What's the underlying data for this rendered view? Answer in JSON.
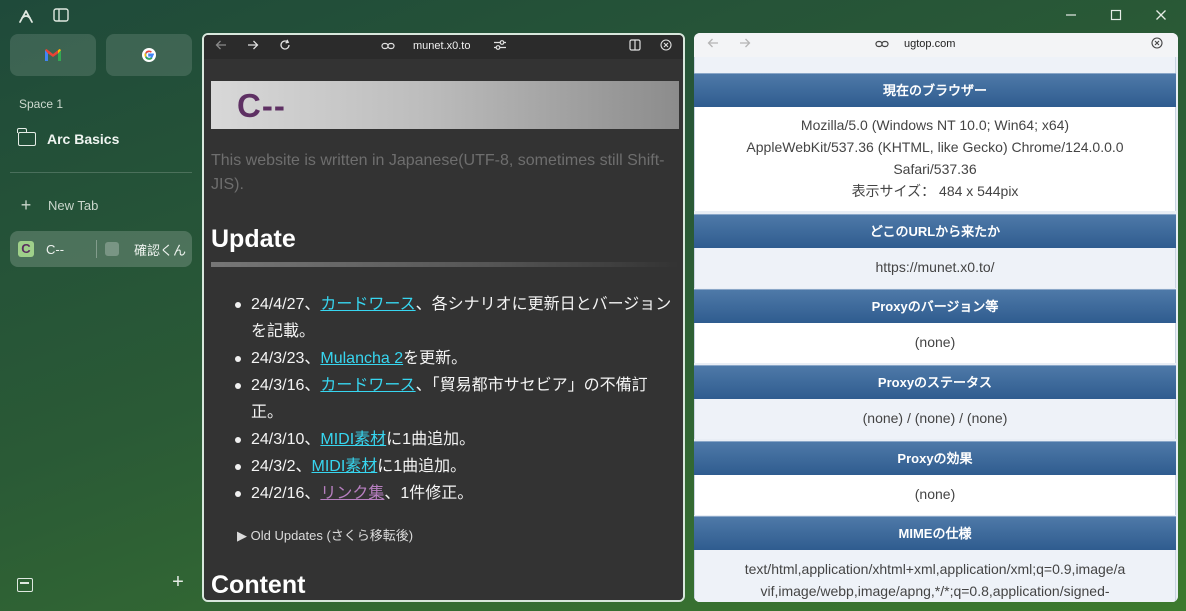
{
  "sidebar": {
    "space_label": "Space 1",
    "folder_label": "Arc Basics",
    "new_tab_label": "New Tab",
    "split_tab": {
      "left_title": "C--",
      "right_title": "確認くん"
    }
  },
  "left_pane": {
    "url": "munet.x0.to",
    "banner_title": "C--",
    "lang_note": "This website is written in Japanese(UTF-8, sometimes still Shift-JIS).",
    "update_heading": "Update",
    "updates": [
      {
        "pre": "24/4/27、",
        "link": "カードワース",
        "post": "、各シナリオに更新日とバージョンを記載。"
      },
      {
        "pre": "24/3/23、",
        "link": "Mulancha 2",
        "post": "を更新。"
      },
      {
        "pre": "24/3/16、",
        "link": "カードワース",
        "post": "、「貿易都市サセビア」の不備訂正。"
      },
      {
        "pre": "24/3/10、",
        "link": "MIDI素材",
        "post": "に1曲追加。"
      },
      {
        "pre": "24/3/2、",
        "link": "MIDI素材",
        "post": "に1曲追加。"
      },
      {
        "pre": "24/2/16、",
        "link": "リンク集",
        "post": "、1件修正。"
      }
    ],
    "old_updates": "▶ Old Updates (さくら移転後)",
    "content_heading": "Content"
  },
  "right_pane": {
    "url": "ugtop.com",
    "sections": [
      {
        "title": "現在のブラウザー",
        "lines": [
          "Mozilla/5.0 (Windows NT 10.0; Win64; x64)",
          "AppleWebKit/537.36 (KHTML, like Gecko) Chrome/124.0.0.0",
          "Safari/537.36",
          "表示サイズ： 484 x 544pix"
        ]
      },
      {
        "title": "どこのURLから来たか",
        "lines": [
          "https://munet.x0.to/"
        ]
      },
      {
        "title": "Proxyのバージョン等",
        "lines": [
          "(none)"
        ]
      },
      {
        "title": "Proxyのステータス",
        "lines": [
          "(none) / (none) / (none)"
        ]
      },
      {
        "title": "Proxyの効果",
        "lines": [
          "(none)"
        ]
      },
      {
        "title": "MIMEの仕様",
        "lines": [
          "text/html,application/xhtml+xml,application/xml;q=0.9,image/a",
          "vif,image/webp,image/apng,*/*;q=0.8,application/signed-"
        ]
      }
    ]
  },
  "colors": {
    "link": "#37d6f0",
    "visited_link": "#b77fc0",
    "section_header": "#2f5c8f",
    "focus_border": "#d8e7dc"
  }
}
